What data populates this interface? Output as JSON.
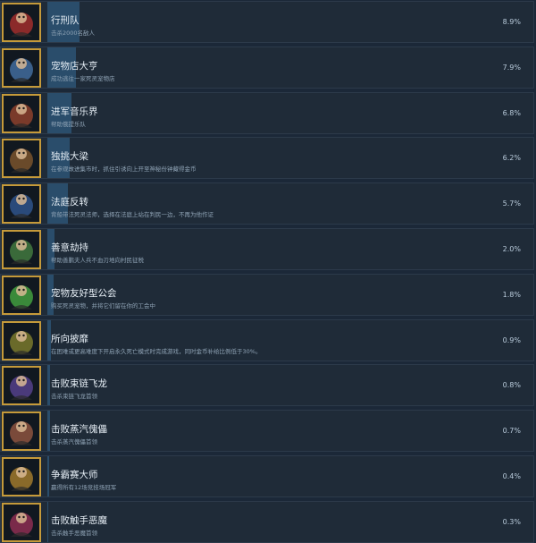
{
  "achievements": [
    {
      "title": "行刑队",
      "desc": "击杀2000名敌人",
      "pct": "8.9%",
      "percent": 8.9,
      "icon": "red-warrior-icon",
      "color": "#8b2a2a"
    },
    {
      "title": "宠物店大亨",
      "desc": "成功逃往一家死灵宠物店",
      "pct": "7.9%",
      "percent": 7.9,
      "icon": "paw-shop-icon",
      "color": "#3a5f8a"
    },
    {
      "title": "进军音乐界",
      "desc": "帮助俄提乐队",
      "pct": "6.8%",
      "percent": 6.8,
      "icon": "music-band-icon",
      "color": "#7a3a2a"
    },
    {
      "title": "独挑大梁",
      "desc": "在参观故进集市时，抓住引诱向上开至神秘份钟藏得金币",
      "pct": "6.2%",
      "percent": 6.2,
      "icon": "weightlifter-icon",
      "color": "#6a4a2a"
    },
    {
      "title": "法庭反转",
      "desc": "背船带法死灵法师，选择在法庭上站在判民一边，不再为他作证",
      "pct": "5.7%",
      "percent": 5.7,
      "icon": "gavel-icon",
      "color": "#2a4a7a"
    },
    {
      "title": "善意劫持",
      "desc": "帮助善鹏夫人兵不血刃地向村民征税",
      "pct": "2.0%",
      "percent": 2.0,
      "icon": "thief-icon",
      "color": "#3a6a3a"
    },
    {
      "title": "宠物友好型公会",
      "desc": "购买死灵宠物，并将它们留在你的工会中",
      "pct": "1.8%",
      "percent": 1.8,
      "icon": "green-pet-icon",
      "color": "#3a8a3a"
    },
    {
      "title": "所向披靡",
      "desc": "在困难或更高难度下开启永久死亡模式时完成游戏，同时金币补给比例低于30%。",
      "pct": "0.9%",
      "percent": 0.9,
      "icon": "golden-fist-icon",
      "color": "#6a6a2a"
    },
    {
      "title": "击败束链飞龙",
      "desc": "击杀束链飞龙首领",
      "pct": "0.8%",
      "percent": 0.8,
      "icon": "chained-dragon-icon",
      "color": "#4a3a7a"
    },
    {
      "title": "击败蒸汽傀儡",
      "desc": "击杀蒸汽傀儡首领",
      "pct": "0.7%",
      "percent": 0.7,
      "icon": "steam-golem-icon",
      "color": "#7a4a3a"
    },
    {
      "title": "争霸赛大师",
      "desc": "赢得所有12场竞技场冠军",
      "pct": "0.4%",
      "percent": 0.4,
      "icon": "champion-icon",
      "color": "#8a6a2a"
    },
    {
      "title": "击败触手恶魔",
      "desc": "击杀触手恶魔首领",
      "pct": "0.3%",
      "percent": 0.3,
      "icon": "tentacle-demon-icon",
      "color": "#7a2a4a"
    }
  ]
}
